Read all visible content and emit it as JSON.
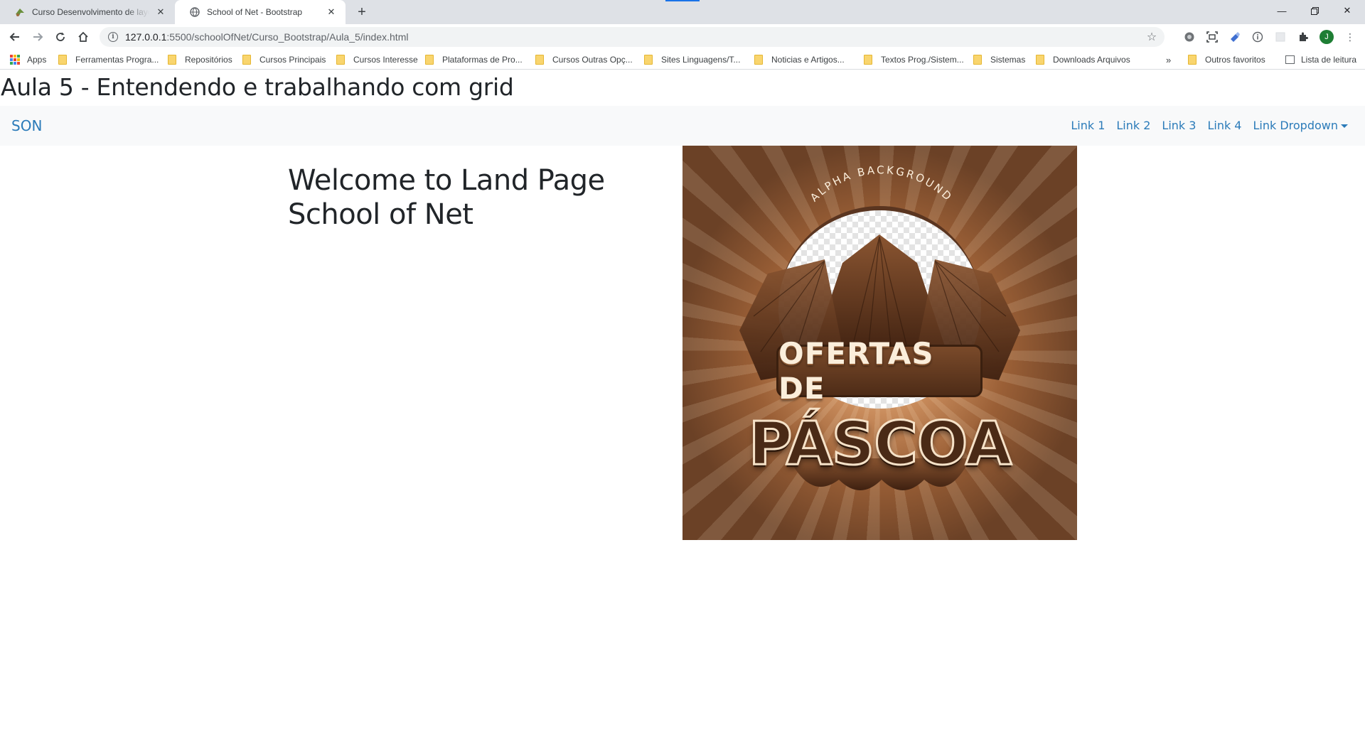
{
  "browser": {
    "tabs": [
      {
        "title": "Curso Desenvolvimento de layout",
        "active": false
      },
      {
        "title": "School of Net - Bootstrap",
        "active": true
      }
    ],
    "url_host": "127.0.0.1",
    "url_path": ":5500/schoolOfNet/Curso_Bootstrap/Aula_5/index.html",
    "avatar_letter": "J",
    "bookmarks": [
      "Apps",
      "Ferramentas Progra...",
      "Repositórios",
      "Cursos Principais",
      "Cursos Interesse",
      "Plataformas de Pro...",
      "Cursos Outras Opç...",
      "Sites Linguagens/T...",
      "Noticias e Artigos...",
      "Textos Prog./Sistem...",
      "Sistemas",
      "Downloads Arquivos"
    ],
    "overflow_chevron": "»",
    "other_bookmarks": "Outros favoritos",
    "reading_list": "Lista de leitura"
  },
  "page": {
    "heading": "Aula 5 - Entendendo e trabalhando com grid",
    "navbar": {
      "brand": "SON",
      "links": [
        "Link 1",
        "Link 2",
        "Link 3",
        "Link 4"
      ],
      "dropdown_label": "Link Dropdown"
    },
    "welcome": "Welcome to Land Page School of Net",
    "hero_image": {
      "arc_text": "ALPHA BACKGROUND",
      "band_text": "OFERTAS DE",
      "big_text": "PÁSCOA"
    }
  },
  "colors": {
    "link": "#2b7bb9",
    "navbar_bg": "#f8f9fa",
    "tabstrip_bg": "#dee1e6",
    "hero_bg": "#6b4126"
  }
}
